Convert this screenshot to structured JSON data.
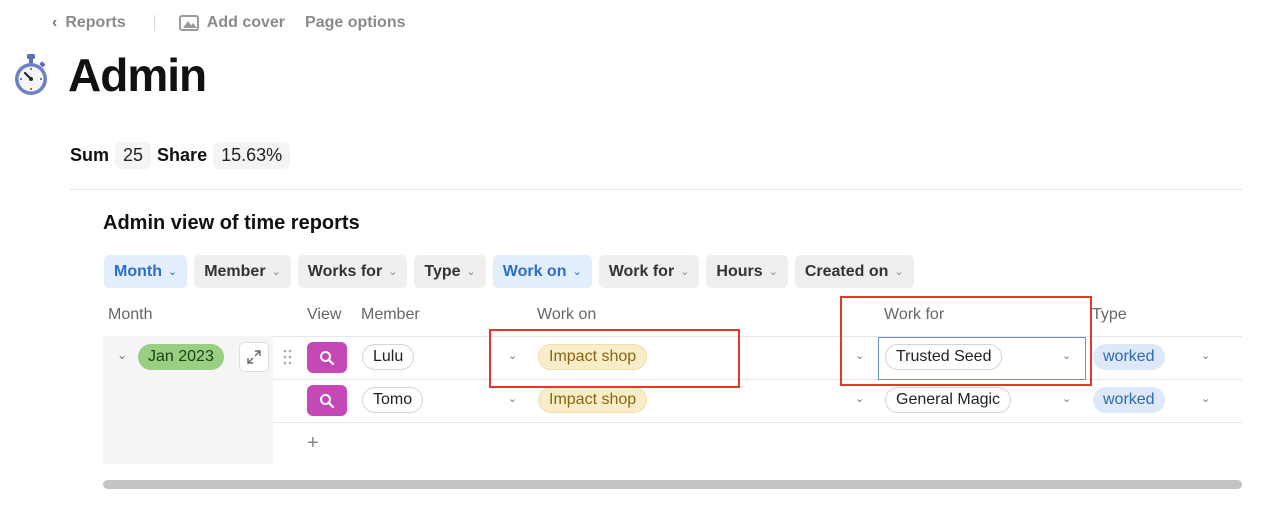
{
  "topbar": {
    "back_label": "Reports",
    "add_cover_label": "Add cover",
    "page_options_label": "Page options"
  },
  "page": {
    "title": "Admin",
    "icon": "stopwatch-icon"
  },
  "stats": {
    "sum_label": "Sum",
    "sum_value": "25",
    "share_label": "Share",
    "share_value": "15.63%"
  },
  "table": {
    "title": "Admin view of time reports",
    "filters": [
      {
        "label": "Month",
        "active": true
      },
      {
        "label": "Member",
        "active": false
      },
      {
        "label": "Works for",
        "active": false
      },
      {
        "label": "Type",
        "active": false
      },
      {
        "label": "Work on",
        "active": true
      },
      {
        "label": "Work for",
        "active": false
      },
      {
        "label": "Hours",
        "active": false
      },
      {
        "label": "Created on",
        "active": false
      }
    ],
    "columns": {
      "month": "Month",
      "view": "View",
      "member": "Member",
      "work_on": "Work on",
      "work_for": "Work for",
      "type": "Type"
    },
    "group": {
      "month": "Jan 2023"
    },
    "rows": [
      {
        "member": "Lulu",
        "work_on": "Impact shop",
        "work_for": "Trusted Seed",
        "type": "worked"
      },
      {
        "member": "Tomo",
        "work_on": "Impact shop",
        "work_for": "General Magic",
        "type": "worked"
      }
    ],
    "add_row_label": "+"
  },
  "colors": {
    "month_pill": "#98cf82",
    "view_button": "#c548b6",
    "work_on_pill": "#f8edc8",
    "type_pill": "#dde8f8",
    "active_filter": "#e2eefb",
    "highlight_box": "#e03a2b"
  }
}
